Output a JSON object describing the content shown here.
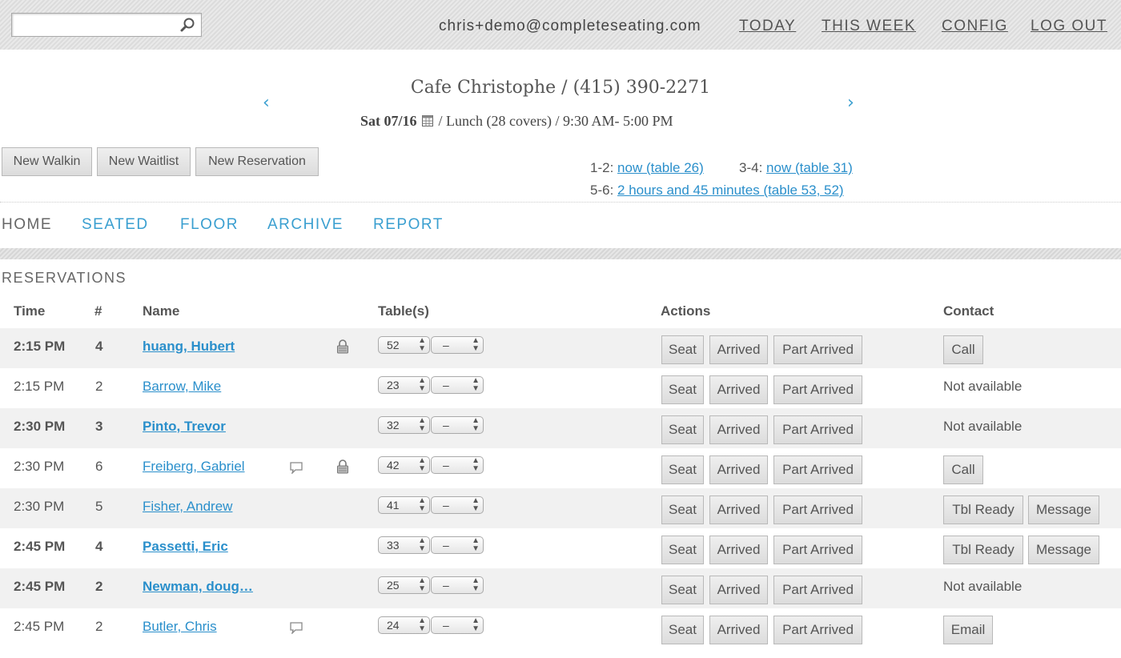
{
  "search": {
    "placeholder": "",
    "value": ""
  },
  "topnav": {
    "email": "chris+demo@completeseating.com",
    "today": "TODAY",
    "this_week": "THIS WEEK",
    "config": "CONFIG",
    "logout": "LOG OUT"
  },
  "header": {
    "restaurant": "Cafe Christophe / (415) 390-2271",
    "date": "Sat 07/16",
    "shift": "/ Lunch (28 covers) / 9:30 AM- 5:00 PM",
    "prev": "‹",
    "next": "›"
  },
  "buttons": {
    "walkin": "New Walkin",
    "waitlist": "New Waitlist",
    "reservation": "New Reservation"
  },
  "waits": {
    "a_label": "1-2:",
    "a_link": "now (table 26)",
    "b_label": "3-4:",
    "b_link": "now (table 31)",
    "c_label": "5-6:",
    "c_link": "2 hours and 45 minutes (table 53, 52)"
  },
  "nav": {
    "home": "HOME",
    "seated": "SEATED",
    "floor": "FLOOR",
    "archive": "ARCHIVE",
    "report": "REPORT"
  },
  "section": "RESERVATIONS",
  "columns": {
    "time": "Time",
    "num": "#",
    "name": "Name",
    "tables": "Table(s)",
    "actions": "Actions",
    "contact": "Contact"
  },
  "actions": {
    "seat": "Seat",
    "arrived": "Arrived",
    "part": "Part Arrived"
  },
  "rows": [
    {
      "time": "2:15 PM",
      "num": "4",
      "name": "huang, Hubert",
      "table": "52",
      "table2": "–",
      "contact1": "Call",
      "contact2": ""
    },
    {
      "time": "2:15 PM",
      "num": "2",
      "name": "Barrow, Mike",
      "table": "23",
      "table2": "–",
      "contact1": "Not available",
      "contact2": ""
    },
    {
      "time": "2:30 PM",
      "num": "3",
      "name": "Pinto, Trevor",
      "table": "32",
      "table2": "–",
      "contact1": "Not available",
      "contact2": ""
    },
    {
      "time": "2:30 PM",
      "num": "6",
      "name": "Freiberg, Gabriel",
      "table": "42",
      "table2": "–",
      "contact1": "Call",
      "contact2": ""
    },
    {
      "time": "2:30 PM",
      "num": "5",
      "name": "Fisher, Andrew",
      "table": "41",
      "table2": "–",
      "contact1": "Tbl Ready",
      "contact2": "Message"
    },
    {
      "time": "2:45 PM",
      "num": "4",
      "name": "Passetti, Eric",
      "table": "33",
      "table2": "–",
      "contact1": "Tbl Ready",
      "contact2": "Message"
    },
    {
      "time": "2:45 PM",
      "num": "2",
      "name": "Newman, doug…",
      "table": "25",
      "table2": "–",
      "contact1": "Not available",
      "contact2": ""
    },
    {
      "time": "2:45 PM",
      "num": "2",
      "name": "Butler, Chris",
      "table": "24",
      "table2": "–",
      "contact1": "Email",
      "contact2": ""
    }
  ]
}
